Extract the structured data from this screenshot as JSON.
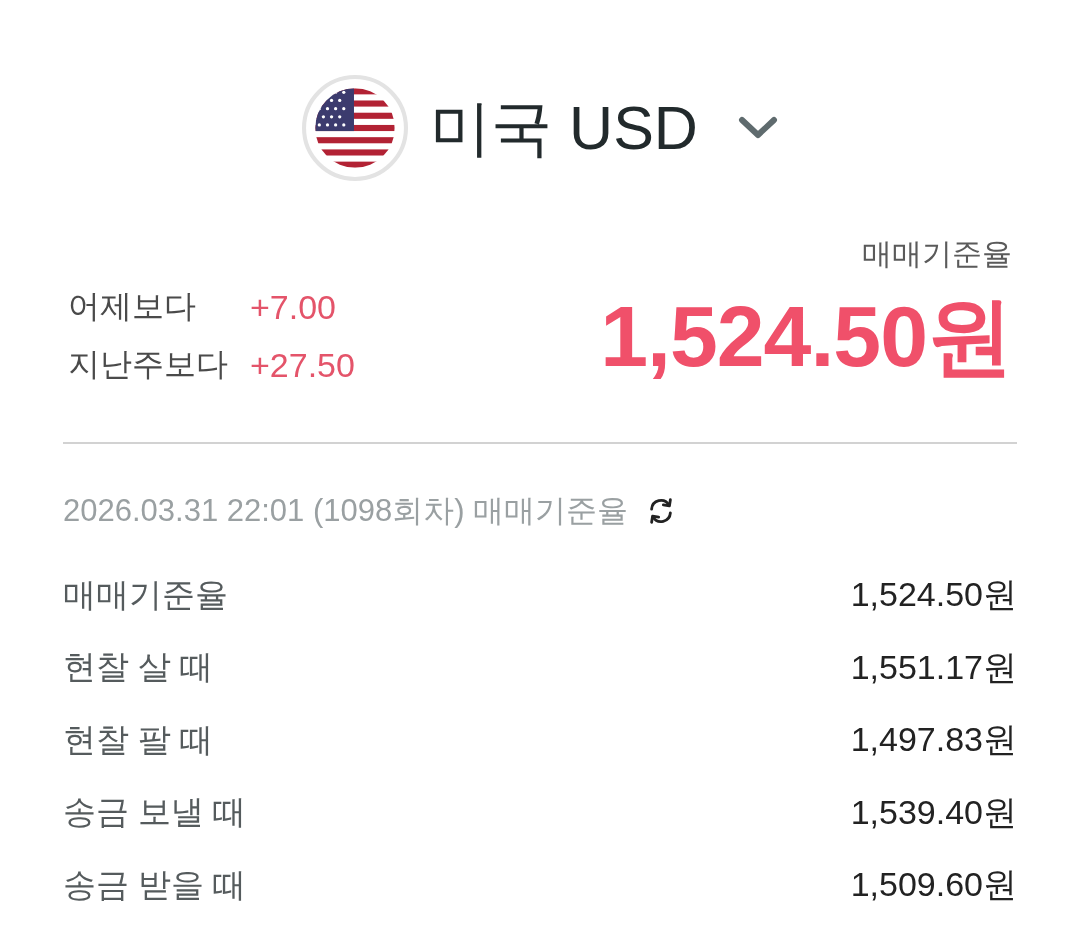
{
  "currency_selector": {
    "title": "미국 USD"
  },
  "rate": {
    "label": "매매기준율",
    "value": "1,524.50원"
  },
  "changes": [
    {
      "label": "어제보다",
      "value": "+7.00"
    },
    {
      "label": "지난주보다",
      "value": "+27.50"
    }
  ],
  "timestamp": {
    "text": "2026.03.31 22:01 (1098회차) 매매기준율"
  },
  "rates": [
    {
      "label": "매매기준율",
      "value": "1,524.50원"
    },
    {
      "label": "현찰 살 때",
      "value": "1,551.17원"
    },
    {
      "label": "현찰 팔 때",
      "value": "1,497.83원"
    },
    {
      "label": "송금 보낼 때",
      "value": "1,539.40원"
    },
    {
      "label": "송금 받을 때",
      "value": "1,509.60원"
    }
  ]
}
